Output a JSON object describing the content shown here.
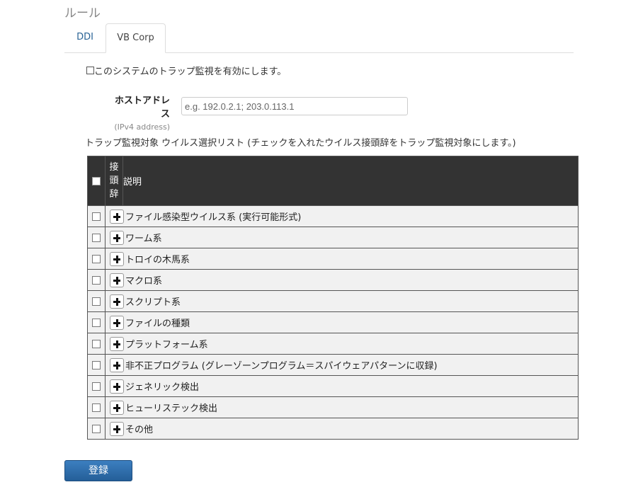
{
  "page_title": "ルール",
  "tabs": [
    {
      "label": "DDI"
    },
    {
      "label": "VB Corp"
    }
  ],
  "enable_label": "このシステムのトラップ監視を有効にします。",
  "host": {
    "label": "ホストアドレス",
    "sublabel": "(IPv4 address)",
    "placeholder": "e.g. 192.0.2.1; 203.0.113.1"
  },
  "list_caption": "トラップ監視対象 ウイルス選択リスト (チェックを入れたウイルス接頭辞をトラップ監視対象にします。)",
  "table": {
    "header_prefix": "接\n頭\n辞",
    "header_desc": "説明",
    "rows": [
      {
        "label": "ファイル感染型ウイルス系 (実行可能形式)"
      },
      {
        "label": "ワーム系"
      },
      {
        "label": "トロイの木馬系"
      },
      {
        "label": "マクロ系"
      },
      {
        "label": "スクリプト系"
      },
      {
        "label": "ファイルの種類"
      },
      {
        "label": "プラットフォーム系"
      },
      {
        "label": "非不正プログラム (グレーゾーンプログラム＝スパイウェアパターンに収録)"
      },
      {
        "label": "ジェネリック検出"
      },
      {
        "label": "ヒューリステック検出"
      },
      {
        "label": "その他"
      }
    ]
  },
  "submit_label": "登録"
}
